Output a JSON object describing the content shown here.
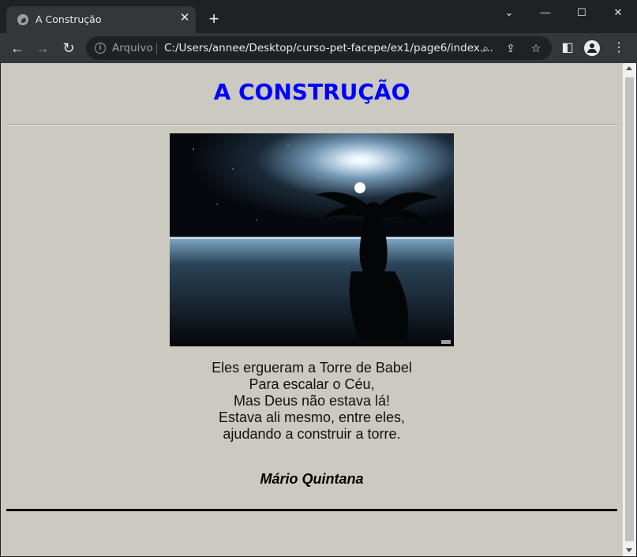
{
  "browser": {
    "tab_title": "A Construção",
    "security_label": "Arquivo",
    "url": "C:/Users/annee/Desktop/curso-pet-facepe/ex1/page6/index...."
  },
  "page": {
    "title": "A CONSTRUÇÃO",
    "poem_lines": [
      "Eles ergueram a Torre de Babel",
      "Para escalar o Céu,",
      "Mas Deus não estava lá!",
      "Estava ali mesmo, entre eles,",
      "ajudando a construir a torre."
    ],
    "author": "Mário Quintana"
  },
  "colors": {
    "page_background": "#ccc9c1",
    "title": "#0000ff",
    "browser_frame": "#202124",
    "toolbar": "#35363a"
  },
  "icons": [
    "globe-icon",
    "close-icon",
    "plus-icon",
    "chevron-down-icon",
    "minimize-icon",
    "maximize-icon",
    "close-window-icon",
    "back-icon",
    "forward-icon",
    "reload-icon",
    "info-icon",
    "zoom-icon",
    "share-icon",
    "star-icon",
    "side-panel-icon",
    "profile-icon",
    "more-icon"
  ]
}
